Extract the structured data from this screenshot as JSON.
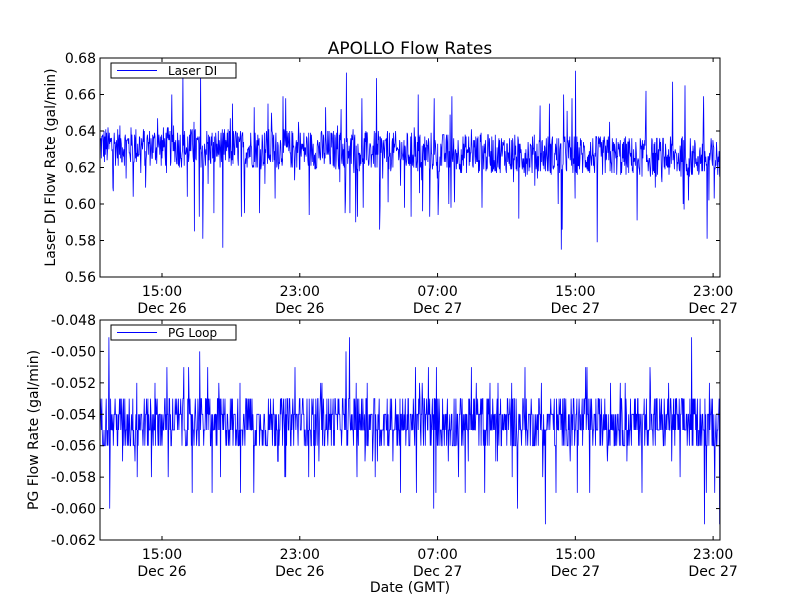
{
  "chart_data": {
    "type": "line",
    "title": "APOLLO Flow Rates",
    "xlabel": "Date (GMT)",
    "x_range": [
      "Dec 26 11:24",
      "Dec 27 23:24"
    ],
    "x_ticks": [
      {
        "time": "15:00",
        "date": "Dec 26",
        "hours": 3.6
      },
      {
        "time": "23:00",
        "date": "Dec 26",
        "hours": 11.6
      },
      {
        "time": "07:00",
        "date": "Dec 27",
        "hours": 19.6
      },
      {
        "time": "15:00",
        "date": "Dec 27",
        "hours": 27.6
      },
      {
        "time": "23:00",
        "date": "Dec 27",
        "hours": 35.6
      }
    ],
    "x_span_hours": 36,
    "panels": [
      {
        "ylabel": "Laser DI Flow Rate (gal/min)",
        "ylim": [
          0.56,
          0.68
        ],
        "y_ticks": [
          "0.56",
          "0.58",
          "0.60",
          "0.62",
          "0.64",
          "0.66",
          "0.68"
        ],
        "y_tick_values": [
          0.56,
          0.58,
          0.6,
          0.62,
          0.64,
          0.66,
          0.68
        ],
        "legend": "Laser DI",
        "legend_position": "top-left",
        "series": {
          "name": "Laser DI",
          "color": "#0000ff",
          "mean_start": 0.632,
          "mean_end": 0.625,
          "band": 0.011,
          "min": 0.574,
          "max": 0.675,
          "quantum": 0.001
        }
      },
      {
        "ylabel": "PG Flow Rate (gal/min)",
        "ylim": [
          -0.062,
          -0.048
        ],
        "y_ticks": [
          "-0.062",
          "-0.060",
          "-0.058",
          "-0.056",
          "-0.054",
          "-0.052",
          "-0.050",
          "-0.048"
        ],
        "y_tick_values": [
          -0.062,
          -0.06,
          -0.058,
          -0.056,
          -0.054,
          -0.052,
          -0.05,
          -0.048
        ],
        "legend": "PG Loop",
        "legend_position": "top-left",
        "series": {
          "name": "PG Loop",
          "color": "#0000ff",
          "mean_start": -0.0545,
          "mean_end": -0.0545,
          "band": 0.0015,
          "min": -0.0611,
          "max": -0.0491,
          "quantum": 0.001
        }
      }
    ]
  }
}
